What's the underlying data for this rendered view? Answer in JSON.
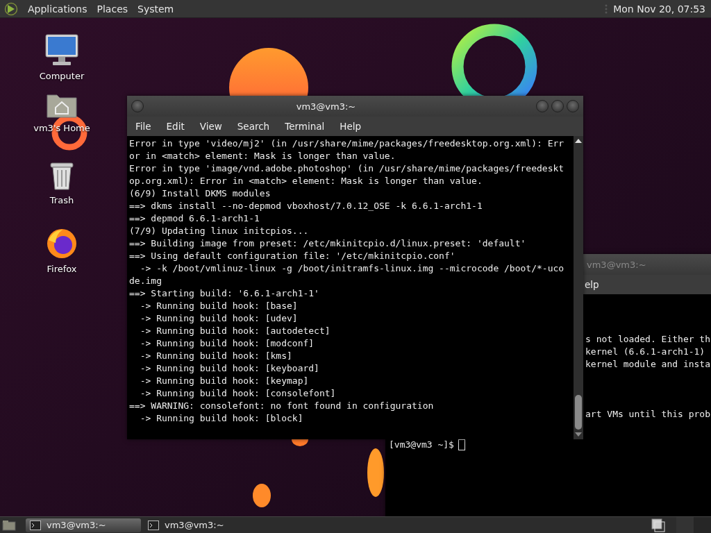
{
  "top_panel": {
    "menus": [
      "Applications",
      "Places",
      "System"
    ],
    "clock": "Mon Nov 20, 07:53"
  },
  "desktop_icons": [
    {
      "label": "Computer",
      "kind": "computer"
    },
    {
      "label": "vm3's Home",
      "kind": "home"
    },
    {
      "label": "Trash",
      "kind": "trash"
    },
    {
      "label": "Firefox",
      "kind": "browser"
    }
  ],
  "windows": [
    {
      "title": "vm3@vm3:~",
      "active": false,
      "menus": [
        "elp"
      ],
      "output": [
        [
          "s not loaded. Either th",
          "kernel (6.6.1-arch1-1)",
          "kernel module and insta"
        ],
        [
          "art VMs until this prob"
        ]
      ],
      "prompt": "[vm3@vm3 ~]$"
    },
    {
      "title": "vm3@vm3:~",
      "active": true,
      "menus": [
        "File",
        "Edit",
        "View",
        "Search",
        "Terminal",
        "Help"
      ],
      "lines": [
        "Error in type 'video/mj2' (in /usr/share/mime/packages/freedesktop.org.xml): Err",
        "or in <match> element: Mask is longer than value.",
        "Error in type 'image/vnd.adobe.photoshop' (in /usr/share/mime/packages/freedeskt",
        "op.org.xml): Error in <match> element: Mask is longer than value.",
        "(6/9) Install DKMS modules",
        "==> dkms install --no-depmod vboxhost/7.0.12_OSE -k 6.6.1-arch1-1",
        "==> depmod 6.6.1-arch1-1",
        "(7/9) Updating linux initcpios...",
        "==> Building image from preset: /etc/mkinitcpio.d/linux.preset: 'default'",
        "==> Using default configuration file: '/etc/mkinitcpio.conf'",
        "  -> -k /boot/vmlinuz-linux -g /boot/initramfs-linux.img --microcode /boot/*-uco",
        "de.img",
        "==> Starting build: '6.6.1-arch1-1'",
        "  -> Running build hook: [base]",
        "  -> Running build hook: [udev]",
        "  -> Running build hook: [autodetect]",
        "  -> Running build hook: [modconf]",
        "  -> Running build hook: [kms]",
        "  -> Running build hook: [keyboard]",
        "  -> Running build hook: [keymap]",
        "  -> Running build hook: [consolefont]",
        "==> WARNING: consolefont: no font found in configuration",
        "  -> Running build hook: [block]"
      ]
    }
  ],
  "taskbar": {
    "tasks": [
      {
        "label": "vm3@vm3:~",
        "selected": true
      },
      {
        "label": "vm3@vm3:~",
        "selected": false
      }
    ]
  }
}
